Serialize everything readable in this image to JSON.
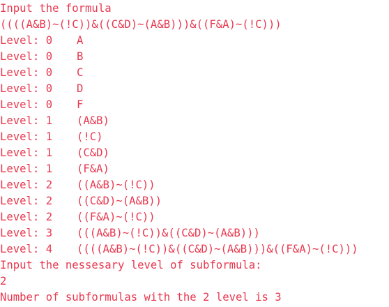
{
  "console": {
    "prompt_formula": "Input the formula",
    "input_formula": "((((A&B)~(!C))&((C&D)~(A&B)))&((F&A)~(!C)))",
    "levels": [
      {
        "label": "Level: 0",
        "formula": "A"
      },
      {
        "label": "Level: 0",
        "formula": "B"
      },
      {
        "label": "Level: 0",
        "formula": "C"
      },
      {
        "label": "Level: 0",
        "formula": "D"
      },
      {
        "label": "Level: 0",
        "formula": "F"
      },
      {
        "label": "Level: 1",
        "formula": "(A&B)"
      },
      {
        "label": "Level: 1",
        "formula": "(!C)"
      },
      {
        "label": "Level: 1",
        "formula": "(C&D)"
      },
      {
        "label": "Level: 1",
        "formula": "(F&A)"
      },
      {
        "label": "Level: 2",
        "formula": "((A&B)~(!C))"
      },
      {
        "label": "Level: 2",
        "formula": "((C&D)~(A&B))"
      },
      {
        "label": "Level: 2",
        "formula": "((F&A)~(!C))"
      },
      {
        "label": "Level: 3",
        "formula": "(((A&B)~(!C))&((C&D)~(A&B)))"
      },
      {
        "label": "Level: 4",
        "formula": "((((A&B)~(!C))&((C&D)~(A&B)))&((F&A)~(!C)))"
      }
    ],
    "prompt_level": "Input the nessesary level of subformula:",
    "input_level": "2",
    "result": "Number of subformulas with the 2 level is 3"
  },
  "colors": {
    "text": "#e8384f",
    "background": "#ffffff"
  }
}
